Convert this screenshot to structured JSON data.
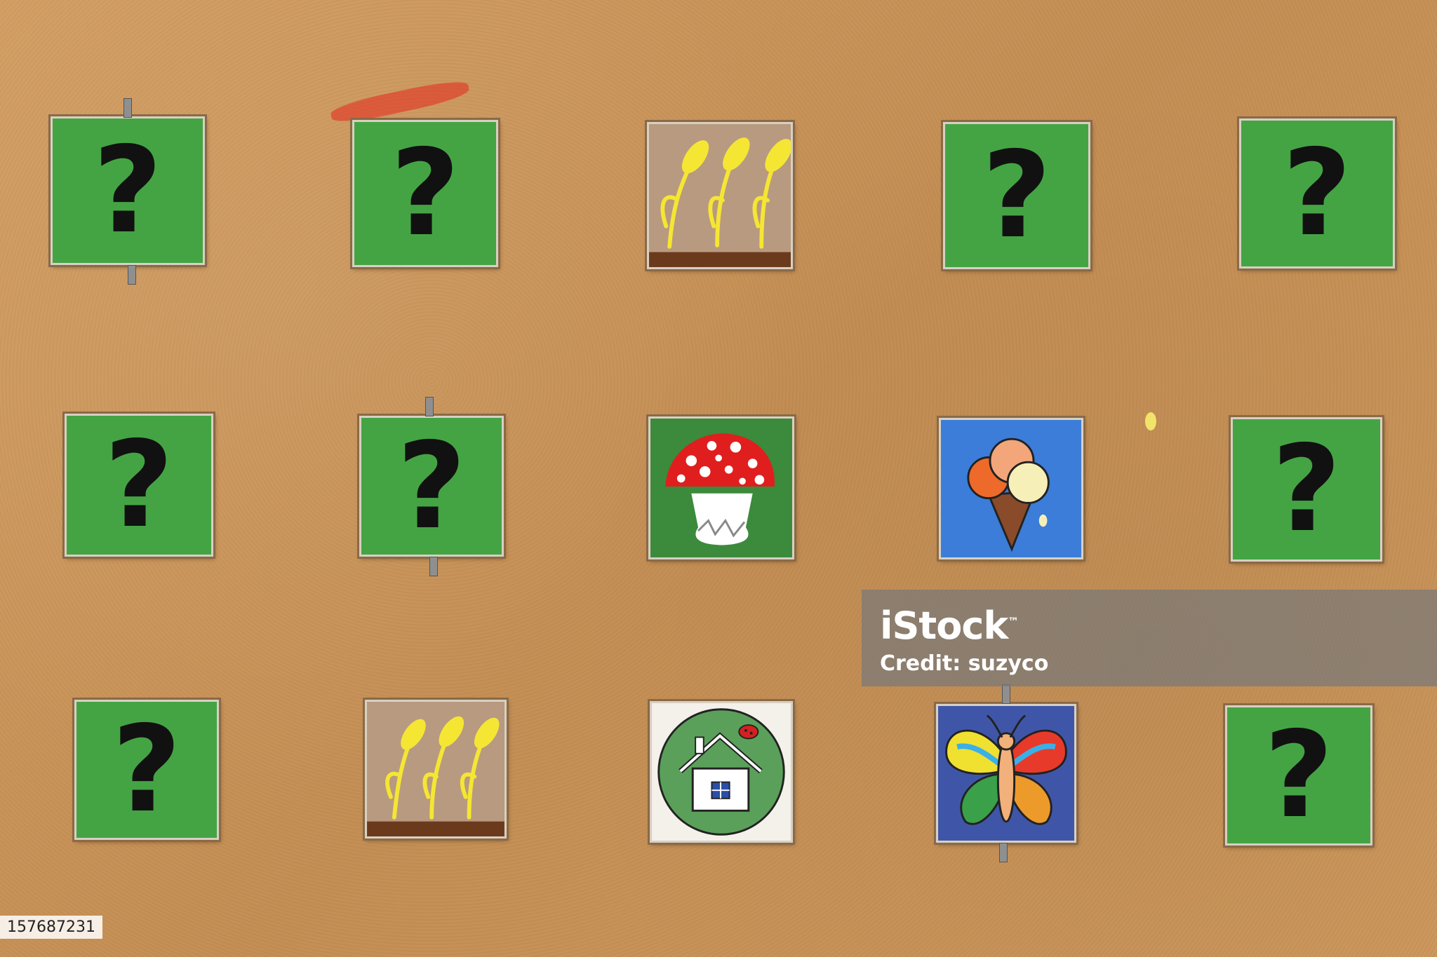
{
  "tiles": {
    "question_mark": "?"
  },
  "watermark": {
    "logo": "iStock",
    "trademark": "™",
    "credit": "Credit: suzyco"
  },
  "image_id": "157687231",
  "colors": {
    "board": "#c9955a",
    "tile_green": "#44a444",
    "tile_brown": "#b89a80",
    "tile_blue": "#3b7dd8",
    "tile_navy": "#3f56a8"
  }
}
